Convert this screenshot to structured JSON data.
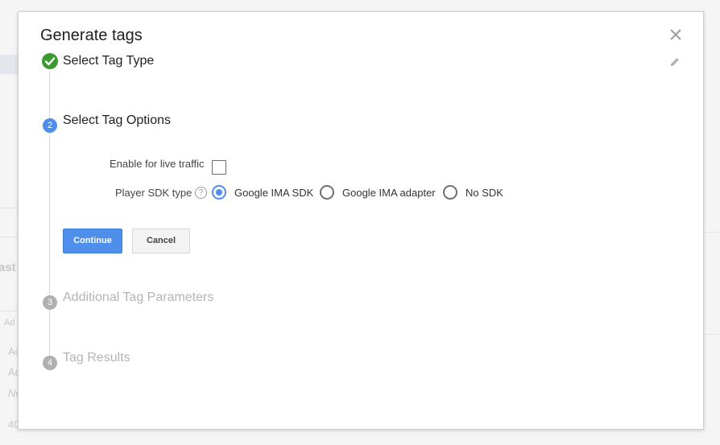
{
  "background": {
    "fragments": [
      "ast",
      "Ad",
      "Ac",
      "Ac",
      "Ne",
      "40"
    ]
  },
  "dialog": {
    "title": "Generate tags",
    "steps": [
      {
        "number": "1",
        "label": "Select Tag Type",
        "state": "done"
      },
      {
        "number": "2",
        "label": "Select Tag Options",
        "state": "current"
      },
      {
        "number": "3",
        "label": "Additional Tag Parameters",
        "state": "future"
      },
      {
        "number": "4",
        "label": "Tag Results",
        "state": "future"
      }
    ],
    "options": {
      "live_traffic_label": "Enable for live traffic",
      "live_traffic_checked": false,
      "sdk_type_label": "Player SDK type",
      "help_glyph": "?",
      "sdk_options": [
        "Google IMA SDK",
        "Google IMA adapter",
        "No SDK"
      ],
      "sdk_selected": "Google IMA SDK"
    },
    "buttons": {
      "continue_label": "Continue",
      "cancel_label": "Cancel"
    }
  },
  "colors": {
    "accent": "#4d8fea",
    "success": "#3b9a2f",
    "inactive_step": "#b0b0b0"
  },
  "icons": {
    "close": "close-icon",
    "edit": "pencil-icon",
    "done": "check-circle-icon",
    "help": "help-circle-icon"
  }
}
